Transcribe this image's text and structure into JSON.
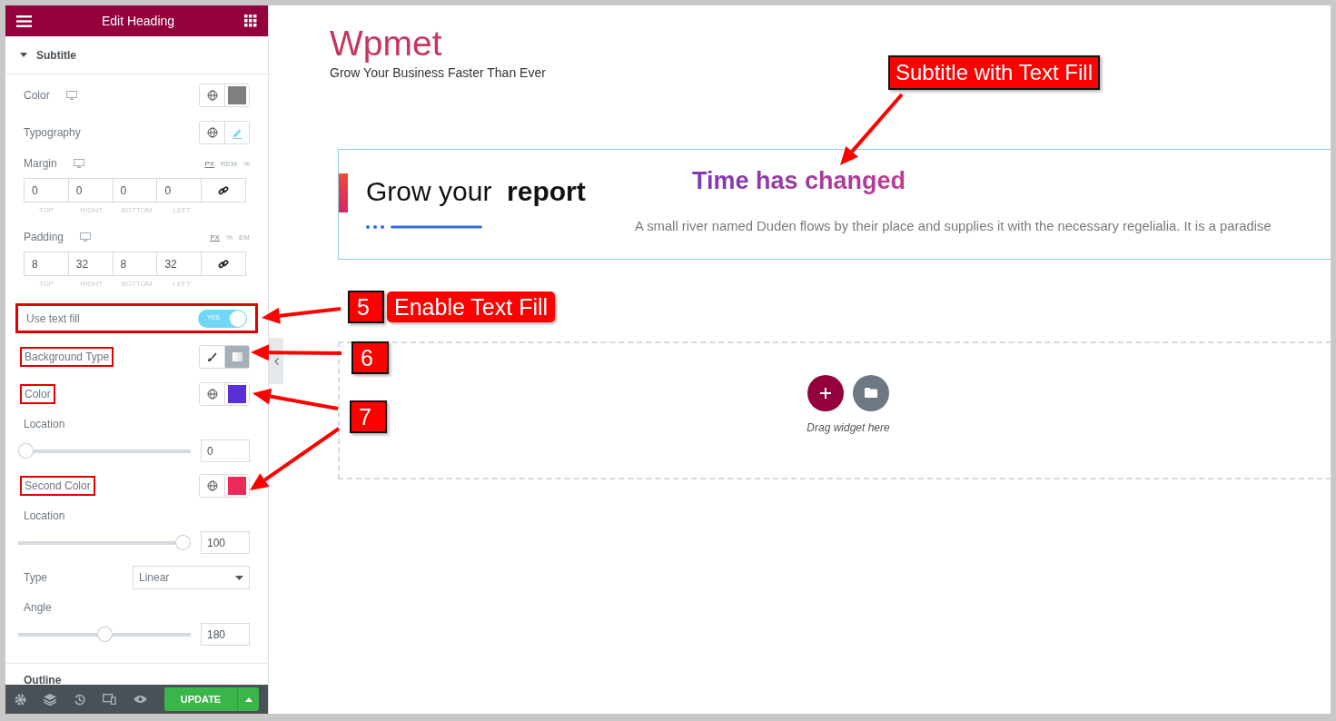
{
  "panel": {
    "title": "Edit Heading",
    "section": {
      "title": "Subtitle",
      "expanded": true
    },
    "controls": [
      {
        "kind": "color",
        "label": "Color",
        "responsive": true,
        "color": "#808080",
        "highlighted": false
      },
      {
        "kind": "typography",
        "label": "Typography"
      },
      {
        "kind": "dimensions",
        "label": "Margin",
        "responsive": true,
        "units": [
          {
            "label": "PX",
            "selected": true
          },
          {
            "label": "REM",
            "selected": false
          },
          {
            "label": "%",
            "selected": false
          }
        ],
        "fields": [
          {
            "value": "0",
            "caption": "TOP"
          },
          {
            "value": "0",
            "caption": "RIGHT"
          },
          {
            "value": "0",
            "caption": "BOTTOM"
          },
          {
            "value": "0",
            "caption": "LEFT"
          }
        ]
      },
      {
        "kind": "dimensions",
        "label": "Padding",
        "responsive": true,
        "units": [
          {
            "label": "PX",
            "selected": true
          },
          {
            "label": "%",
            "selected": false
          },
          {
            "label": "EM",
            "selected": false
          }
        ],
        "fields": [
          {
            "value": "8",
            "caption": "TOP"
          },
          {
            "value": "32",
            "caption": "RIGHT"
          },
          {
            "value": "8",
            "caption": "BOTTOM"
          },
          {
            "value": "32",
            "caption": "LEFT"
          }
        ]
      },
      {
        "kind": "switch",
        "label": "Use text fill",
        "on": true,
        "switch_text": "YES",
        "highlighted": true
      },
      {
        "kind": "choose",
        "label": "Background Type",
        "highlighted": true,
        "options": [
          {
            "kind": "brush",
            "selected": false
          },
          {
            "kind": "gradient",
            "selected": true
          }
        ]
      },
      {
        "kind": "color",
        "label": "Color",
        "responsive": false,
        "color": "#5b2fd6",
        "highlighted": true
      },
      {
        "kind": "slider",
        "label": "Location",
        "level": 0,
        "value": "0"
      },
      {
        "kind": "color",
        "label": "Second Color",
        "responsive": false,
        "color": "#f0285a",
        "highlighted": true
      },
      {
        "kind": "slider",
        "label": "Location",
        "level": 1,
        "value": "100"
      },
      {
        "kind": "select",
        "label": "Type",
        "value": "Linear"
      },
      {
        "kind": "slider",
        "label": "Angle",
        "level": 0.5,
        "value": "180"
      }
    ],
    "next_section": "Outline",
    "footer": {
      "update": "UPDATE"
    }
  },
  "canvas": {
    "site_title": "Wpmet",
    "tagline": "Grow Your Business Faster Than Ever",
    "heading": {
      "title": "Grow your  **report**",
      "subtitle": "Time has changed",
      "description": "A small river named Duden flows by their place and supplies it with the necessary regelialia. It is a paradise"
    },
    "dropzone": {
      "hint": "Drag widget here"
    }
  },
  "annotations": [
    {
      "kind": "step",
      "number": "5",
      "label": "Enable Text Fill"
    },
    {
      "kind": "step",
      "number": "6"
    },
    {
      "kind": "step",
      "number": "7"
    },
    {
      "kind": "callout",
      "label": "Subtitle with Text Fill"
    }
  ]
}
